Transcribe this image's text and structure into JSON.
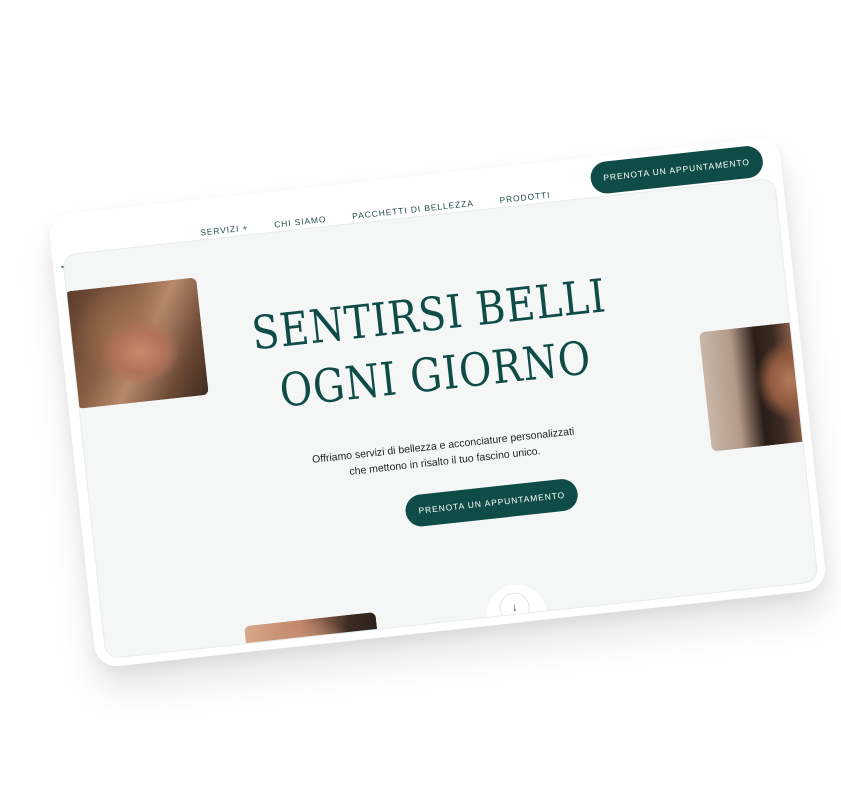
{
  "nav": {
    "items": [
      {
        "label": "SERVIZI +"
      },
      {
        "label": "CHI SIAMO"
      },
      {
        "label": "PACCHETTI DI BELLEZZA"
      },
      {
        "label": "PRODOTTI"
      }
    ],
    "cta_label": "PRENOTA UN APPUNTAMENTO"
  },
  "hero": {
    "title_line1": "SENTIRSI BELLI",
    "title_line2": "OGNI GIORNO",
    "subtitle_line1": "Offriamo servizi di bellezza e acconciature personalizzati",
    "subtitle_line2": "che mettono in risalto il tuo fascino unico.",
    "cta_label": "PRENOTA UN APPUNTAMENTO",
    "scroll_icon": "arrow-down-icon"
  },
  "icons": {
    "logo": "lotus-logo-icon"
  },
  "colors": {
    "accent": "#0f4c47",
    "background": "#f5f7f7",
    "frame": "#ffffff"
  }
}
